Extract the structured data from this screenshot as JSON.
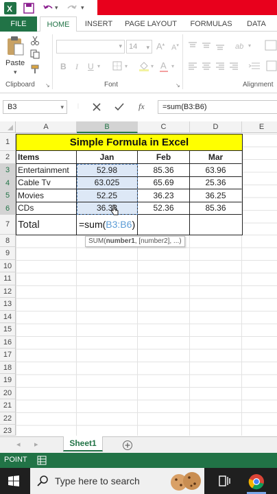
{
  "ribbon_tabs": [
    "FILE",
    "HOME",
    "INSERT",
    "PAGE LAYOUT",
    "FORMULAS",
    "DATA"
  ],
  "ribbon": {
    "paste_label": "Paste",
    "font_size": "14",
    "clipboard_label": "Clipboard",
    "font_label": "Font",
    "alignment_label": "Alignment",
    "bold": "B",
    "italic": "I",
    "underline": "U"
  },
  "formula_bar": {
    "name_box": "B3",
    "fx_label": "fx",
    "formula": "=sum(B3:B6)"
  },
  "columns": [
    "A",
    "B",
    "C",
    "D",
    "E"
  ],
  "rows": [
    "1",
    "2",
    "3",
    "4",
    "5",
    "6",
    "7",
    "8",
    "9",
    "10",
    "11",
    "12",
    "13",
    "14",
    "15",
    "16",
    "17",
    "18",
    "19",
    "20",
    "21",
    "22",
    "23"
  ],
  "sheet": {
    "title": "Simple Formula in Excel",
    "headers": [
      "Items",
      "Jan",
      "Feb",
      "Mar"
    ],
    "data": [
      [
        "Entertainment",
        "52.98",
        "85.36",
        "63.96"
      ],
      [
        "Cable Tv",
        "63.025",
        "65.69",
        "25.36"
      ],
      [
        "Movies",
        "52.25",
        "36.23",
        "36.25"
      ],
      [
        "CDs",
        "36.33",
        "52.36",
        "85.36"
      ]
    ],
    "total_label": "Total",
    "formula_prefix": "=sum(",
    "formula_range": "B3:B6",
    "formula_suffix": ")",
    "tooltip_fn": "SUM(",
    "tooltip_arg1": "number1",
    "tooltip_rest": ", [number2], ...)"
  },
  "sheet_tab": "Sheet1",
  "status": "POINT",
  "taskbar": {
    "search_placeholder": "Type here to search"
  },
  "colors": {
    "excel_green": "#217346",
    "title_yellow": "#ffff00",
    "range_blue": "#5b9bd5",
    "title_red": "#e8001c"
  }
}
